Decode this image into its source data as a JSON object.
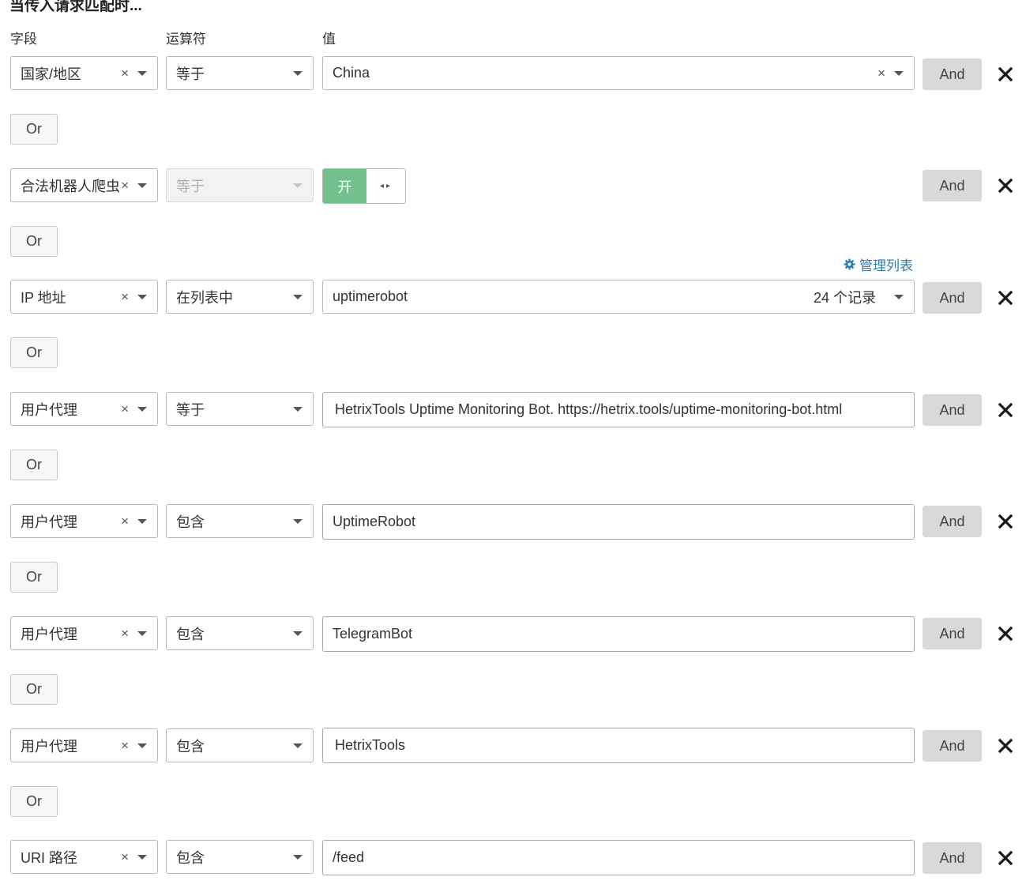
{
  "heading": "当传入请求匹配时...",
  "columns": {
    "field": "字段",
    "operator": "运算符",
    "value": "值"
  },
  "and_label": "And",
  "or_label": "Or",
  "clear_symbol": "×",
  "manage_list_label": "管理列表",
  "toggle_on_label": "开",
  "toggle_handle_glyph": "◂▸",
  "colors": {
    "toggle_on": "#72c08e",
    "link": "#2c7cb0",
    "and_button": "#d9d9d9"
  },
  "rules": [
    {
      "field": "国家/地区",
      "operator": "等于",
      "value": "China",
      "value_type": "select"
    },
    {
      "field": "合法机器人爬虫",
      "operator": "等于",
      "operator_disabled": true,
      "value_type": "toggle",
      "value": "开"
    },
    {
      "field": "IP 地址",
      "operator": "在列表中",
      "value": "uptimerobot",
      "value_count": "24 个记录",
      "value_type": "list-select"
    },
    {
      "field": "用户代理",
      "operator": "等于",
      "value": "HetrixTools Uptime Monitoring Bot. https://hetrix.tools/uptime-monitoring-bot.html",
      "value_type": "text"
    },
    {
      "field": "用户代理",
      "operator": "包含",
      "value": "UptimeRobot",
      "value_type": "text"
    },
    {
      "field": "用户代理",
      "operator": "包含",
      "value": "TelegramBot",
      "value_type": "text"
    },
    {
      "field": "用户代理",
      "operator": "包含",
      "value": "HetrixTools",
      "value_type": "text"
    },
    {
      "field": "URI 路径",
      "operator": "包含",
      "value": "/feed",
      "value_type": "text"
    }
  ]
}
